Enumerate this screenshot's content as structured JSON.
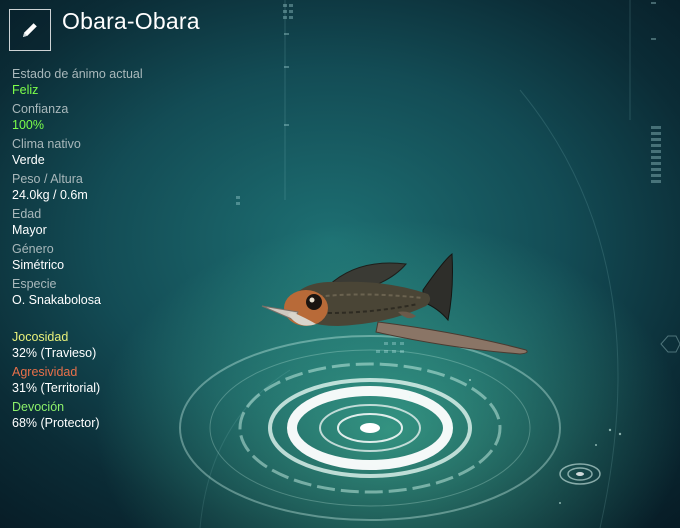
{
  "creature": {
    "name": "Obara-Obara",
    "edit_icon": "pencil-icon"
  },
  "stats": [
    {
      "label": "Estado de ánimo actual",
      "value": "Feliz",
      "highlight": true
    },
    {
      "label": "Confianza",
      "value": "100%",
      "highlight": true
    },
    {
      "label": "Clima nativo",
      "value": "Verde",
      "highlight": false
    },
    {
      "label": "Peso / Altura",
      "value": "24.0kg / 0.6m",
      "highlight": false
    },
    {
      "label": "Edad",
      "value": "Mayor",
      "highlight": false
    },
    {
      "label": "Género",
      "value": "Simétrico",
      "highlight": false
    },
    {
      "label": "Especie",
      "value": "O. Snakabolosa",
      "highlight": false
    }
  ],
  "traits": [
    {
      "label": "Jocosidad",
      "value": "32% (Travieso)",
      "color": "#e8f07a"
    },
    {
      "label": "Agresividad",
      "value": "31% (Territorial)",
      "color": "#e8704a"
    },
    {
      "label": "Devoción",
      "value": "68% (Protector)",
      "color": "#8cf06a"
    }
  ],
  "colors": {
    "highlight_green": "#7cff4a",
    "label_gray": "#a9b8bb",
    "platform_glow": "#9af5da"
  }
}
